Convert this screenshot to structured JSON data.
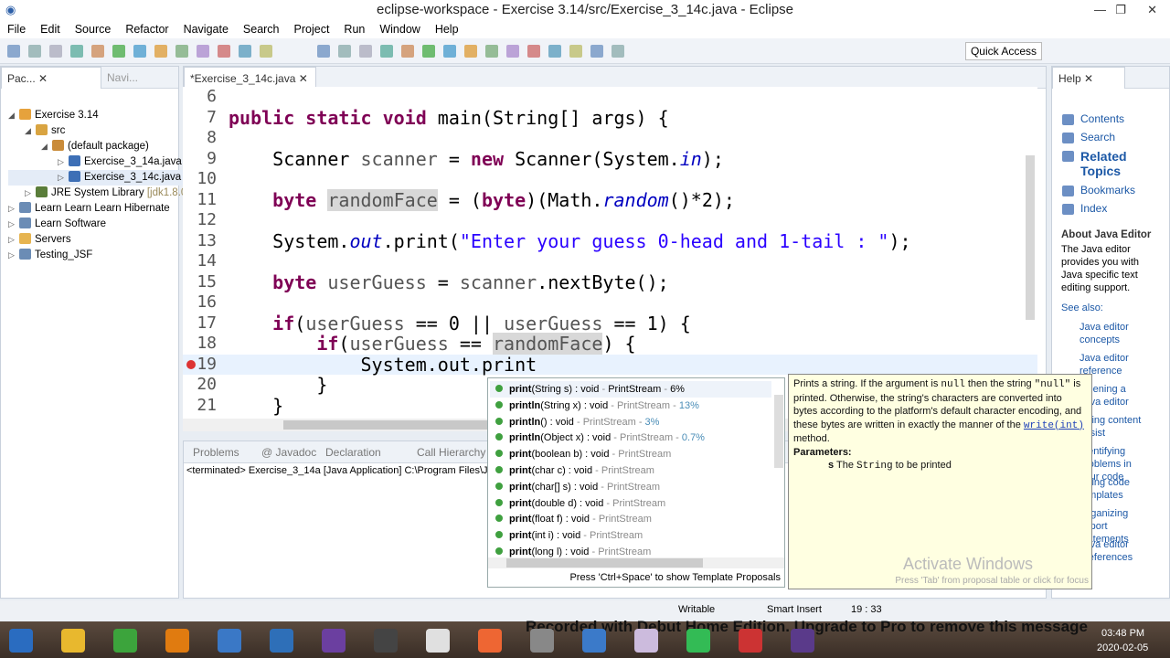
{
  "window": {
    "title": "eclipse-workspace - Exercise 3.14/src/Exercise_3_14c.java - Eclipse"
  },
  "menu": [
    "File",
    "Edit",
    "Source",
    "Refactor",
    "Navigate",
    "Search",
    "Project",
    "Run",
    "Window",
    "Help"
  ],
  "toolbar": {
    "quick_access": "Quick Access"
  },
  "left_panel": {
    "tabs": [
      "Pac...",
      "Navi..."
    ],
    "tree": [
      {
        "label": "Exercise 3.14",
        "level": 0,
        "arrow": "◢"
      },
      {
        "label": "src",
        "level": 1,
        "arrow": "◢"
      },
      {
        "label": "(default package)",
        "level": 2,
        "arrow": "◢"
      },
      {
        "label": "Exercise_3_14a.java",
        "level": 3,
        "arrow": "▷"
      },
      {
        "label": "Exercise_3_14c.java",
        "level": 3,
        "arrow": "▷"
      },
      {
        "label": "JRE System Library",
        "suffix": "[jdk1.8.0",
        "level": 1,
        "arrow": "▷"
      },
      {
        "label": "Learn Learn Learn Hibernate",
        "level": 0,
        "arrow": "▷"
      },
      {
        "label": "Learn Software",
        "level": 0,
        "arrow": "▷"
      },
      {
        "label": "Servers",
        "level": 0,
        "arrow": "▷"
      },
      {
        "label": "Testing_JSF",
        "level": 0,
        "arrow": "▷"
      }
    ]
  },
  "editor": {
    "tab": "*Exercise_3_14c.java",
    "lines": [
      {
        "n": "6",
        "t": []
      },
      {
        "n": "7",
        "t": [
          [
            "public static void ",
            "kw"
          ],
          [
            "main(String[] args) {",
            ""
          ]
        ]
      },
      {
        "n": "8",
        "t": []
      },
      {
        "n": "9",
        "t": [
          [
            "    Scanner ",
            ""
          ],
          [
            "scanner",
            "var"
          ],
          [
            " = ",
            ""
          ],
          [
            "new",
            "kw"
          ],
          [
            " Scanner(System.",
            ""
          ],
          [
            "in",
            "fld"
          ],
          [
            ");",
            ""
          ]
        ]
      },
      {
        "n": "10",
        "t": []
      },
      {
        "n": "11",
        "t": [
          [
            "    ",
            ""
          ],
          [
            "byte",
            "kw"
          ],
          [
            " ",
            ""
          ],
          [
            "randomFace",
            "var hl"
          ],
          [
            " = (",
            ""
          ],
          [
            "byte",
            "kw"
          ],
          [
            ")(Math.",
            ""
          ],
          [
            "random",
            "fld"
          ],
          [
            "()*2);",
            ""
          ]
        ]
      },
      {
        "n": "12",
        "t": []
      },
      {
        "n": "13",
        "t": [
          [
            "    System.",
            ""
          ],
          [
            "out",
            "fld"
          ],
          [
            ".print(",
            ""
          ],
          [
            "\"Enter your guess 0-head and 1-tail : \"",
            "str"
          ],
          [
            ");",
            ""
          ]
        ]
      },
      {
        "n": "14",
        "t": []
      },
      {
        "n": "15",
        "t": [
          [
            "    ",
            ""
          ],
          [
            "byte",
            "kw"
          ],
          [
            " ",
            ""
          ],
          [
            "userGuess",
            "var"
          ],
          [
            " = ",
            ""
          ],
          [
            "scanner",
            "var"
          ],
          [
            ".nextByte();",
            ""
          ]
        ]
      },
      {
        "n": "16",
        "t": []
      },
      {
        "n": "17",
        "t": [
          [
            "    ",
            ""
          ],
          [
            "if",
            "kw"
          ],
          [
            "(",
            ""
          ],
          [
            "userGuess",
            "var"
          ],
          [
            " == 0 || ",
            ""
          ],
          [
            "userGuess",
            "var"
          ],
          [
            " == 1) {",
            ""
          ]
        ]
      },
      {
        "n": "18",
        "t": [
          [
            "        ",
            ""
          ],
          [
            "if",
            "kw"
          ],
          [
            "(",
            ""
          ],
          [
            "userGuess",
            "var"
          ],
          [
            " == ",
            ""
          ],
          [
            "randomFace",
            "var hl"
          ],
          [
            ") {",
            ""
          ]
        ]
      },
      {
        "n": "19",
        "t": [
          [
            "            System.out.print",
            ""
          ]
        ]
      },
      {
        "n": "20",
        "t": [
          [
            "        }",
            ""
          ]
        ]
      },
      {
        "n": "21",
        "t": [
          [
            "    }",
            ""
          ]
        ]
      }
    ]
  },
  "bottom_panel": {
    "tabs": [
      "Problems",
      "@ Javadoc",
      "Declaration",
      "Call Hierarchy"
    ],
    "console": "<terminated> Exercise_3_14a [Java Application] C:\\Program Files\\J"
  },
  "completion": {
    "items": [
      {
        "b": "print",
        "rest": "(String s) : void",
        "type": "PrintStream",
        "pct": "6%",
        "star": true
      },
      {
        "b": "println",
        "rest": "(String x) : void",
        "type": "PrintStream",
        "pct": "13%",
        "star": true
      },
      {
        "b": "println",
        "rest": "() : void",
        "type": "PrintStream",
        "pct": "3%",
        "star": true
      },
      {
        "b": "println",
        "rest": "(Object x) : void",
        "type": "PrintStream",
        "pct": "0.7%",
        "star": true
      },
      {
        "b": "print",
        "rest": "(boolean b) : void",
        "type": "PrintStream"
      },
      {
        "b": "print",
        "rest": "(char c) : void",
        "type": "PrintStream"
      },
      {
        "b": "print",
        "rest": "(char[] s) : void",
        "type": "PrintStream"
      },
      {
        "b": "print",
        "rest": "(double d) : void",
        "type": "PrintStream"
      },
      {
        "b": "print",
        "rest": "(float f) : void",
        "type": "PrintStream"
      },
      {
        "b": "print",
        "rest": "(int i) : void",
        "type": "PrintStream"
      },
      {
        "b": "print",
        "rest": "(long l) : void",
        "type": "PrintStream"
      }
    ],
    "footer": "Press 'Ctrl+Space' to show Template Proposals"
  },
  "doc": {
    "p1": "Prints a string. If the argument is ",
    "null": "null",
    "p2": " then the string ",
    "qnull": "\"null\"",
    "p3": " is printed. Otherwise, the string's characters are converted into bytes according to the platform's default character encoding, and these bytes are written in exactly the manner of the ",
    "link": "write(int)",
    "p4": " method.",
    "params": "Parameters:",
    "param_s": "s",
    "param_pre": " The ",
    "param_code": "String",
    "param_post": " to be printed",
    "watermark": "Activate Windows",
    "footer": "Press 'Tab' from proposal table or click for focus"
  },
  "help": {
    "tab": "Help",
    "links": [
      "Contents",
      "Search",
      "Related Topics",
      "Bookmarks",
      "Index"
    ],
    "about_title": "About Java Editor",
    "about_text": "The Java editor provides you with Java specific text editing support.",
    "see_also": "See also:",
    "see_links": [
      "Java editor concepts",
      "Java editor reference",
      "Opening a Java editor",
      "Using content assist",
      "Identifying problems in your code",
      "Using code templates",
      "Organizing import statements",
      "Java editor preferences"
    ]
  },
  "status": {
    "writable": "Writable",
    "insert": "Smart Insert",
    "position": "19 : 33"
  },
  "taskbar": {
    "banner": "Recorded with Debut Home Edition. Upgrade to Pro to remove this message",
    "time": "03:48 PM",
    "date": "2020-02-05"
  }
}
